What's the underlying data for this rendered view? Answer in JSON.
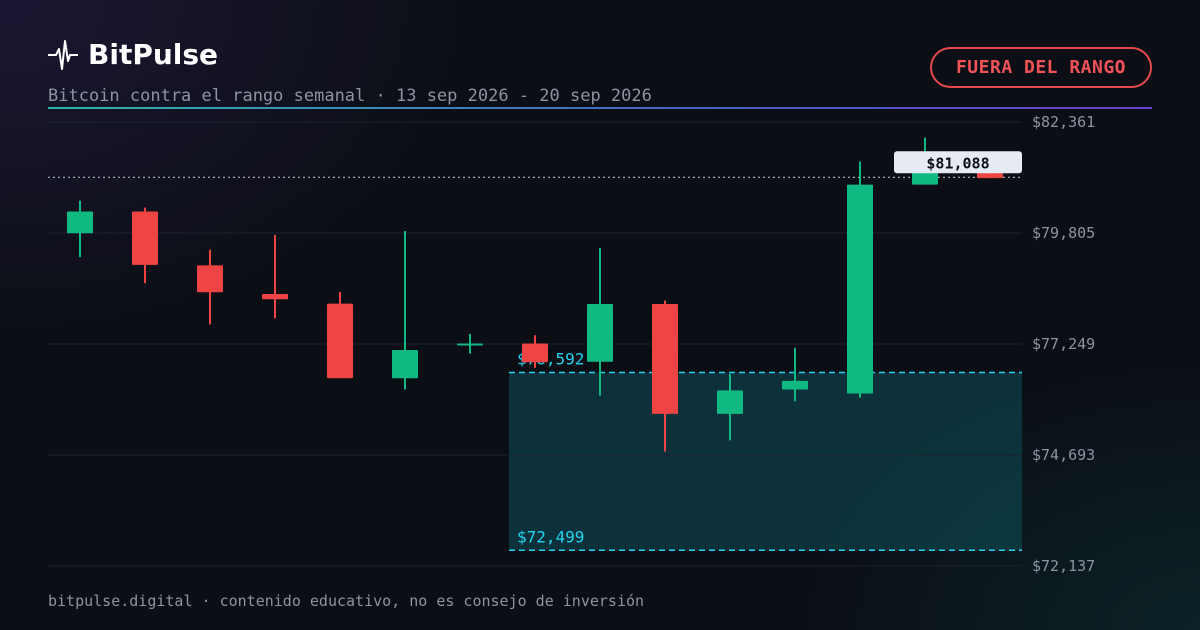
{
  "brand": {
    "name": "BitPulse",
    "logo_icon": "pulse-icon"
  },
  "subtitle": "Bitcoin contra el rango semanal · 13 sep 2026 - 20 sep 2026",
  "badge": {
    "label": "FUERA DEL RANGO",
    "color": "#e5484d"
  },
  "footer": "bitpulse.digital · contenido educativo, no es consejo de inversión",
  "colors": {
    "up": "#10b981",
    "down": "#ef4444",
    "range": "#22d3ee",
    "grid": "#1c2230"
  },
  "chart_data": {
    "type": "candlestick",
    "y_ticks": [
      72137,
      74693,
      77249,
      79805,
      82361
    ],
    "y_tick_labels": [
      "$72,137",
      "$74,693",
      "$77,249",
      "$79,805",
      "$82,361"
    ],
    "ylim": [
      72137,
      82361
    ],
    "candles": [
      {
        "open": 79800,
        "high": 80550,
        "low": 79250,
        "close": 80300
      },
      {
        "open": 80300,
        "high": 80390,
        "low": 78650,
        "close": 79070
      },
      {
        "open": 79060,
        "high": 79420,
        "low": 77700,
        "close": 78440
      },
      {
        "open": 78400,
        "high": 79760,
        "low": 77840,
        "close": 78280
      },
      {
        "open": 78180,
        "high": 78450,
        "low": 76570,
        "close": 76460
      },
      {
        "open": 76460,
        "high": 79850,
        "low": 76200,
        "close": 77110
      },
      {
        "open": 77250,
        "high": 77480,
        "low": 77030,
        "close": 77260
      },
      {
        "open": 77260,
        "high": 77450,
        "low": 76700,
        "close": 76830
      },
      {
        "open": 76840,
        "high": 79460,
        "low": 76060,
        "close": 78170
      },
      {
        "open": 78170,
        "high": 78250,
        "low": 74770,
        "close": 75640
      },
      {
        "open": 75640,
        "high": 76560,
        "low": 75030,
        "close": 76180
      },
      {
        "open": 76200,
        "high": 77160,
        "low": 75930,
        "close": 76400
      },
      {
        "open": 76110,
        "high": 81450,
        "low": 76010,
        "close": 80920
      },
      {
        "open": 80920,
        "high": 82000,
        "low": 80950,
        "close": 81330
      },
      {
        "open": 81190,
        "high": 81180,
        "low": 81070,
        "close": 81070
      }
    ],
    "current_price": 81088,
    "current_price_label": "$81,088",
    "range": {
      "high": 76592,
      "low": 72499,
      "high_label": "$76,592",
      "low_label": "$72,499",
      "start_index": 7
    }
  }
}
